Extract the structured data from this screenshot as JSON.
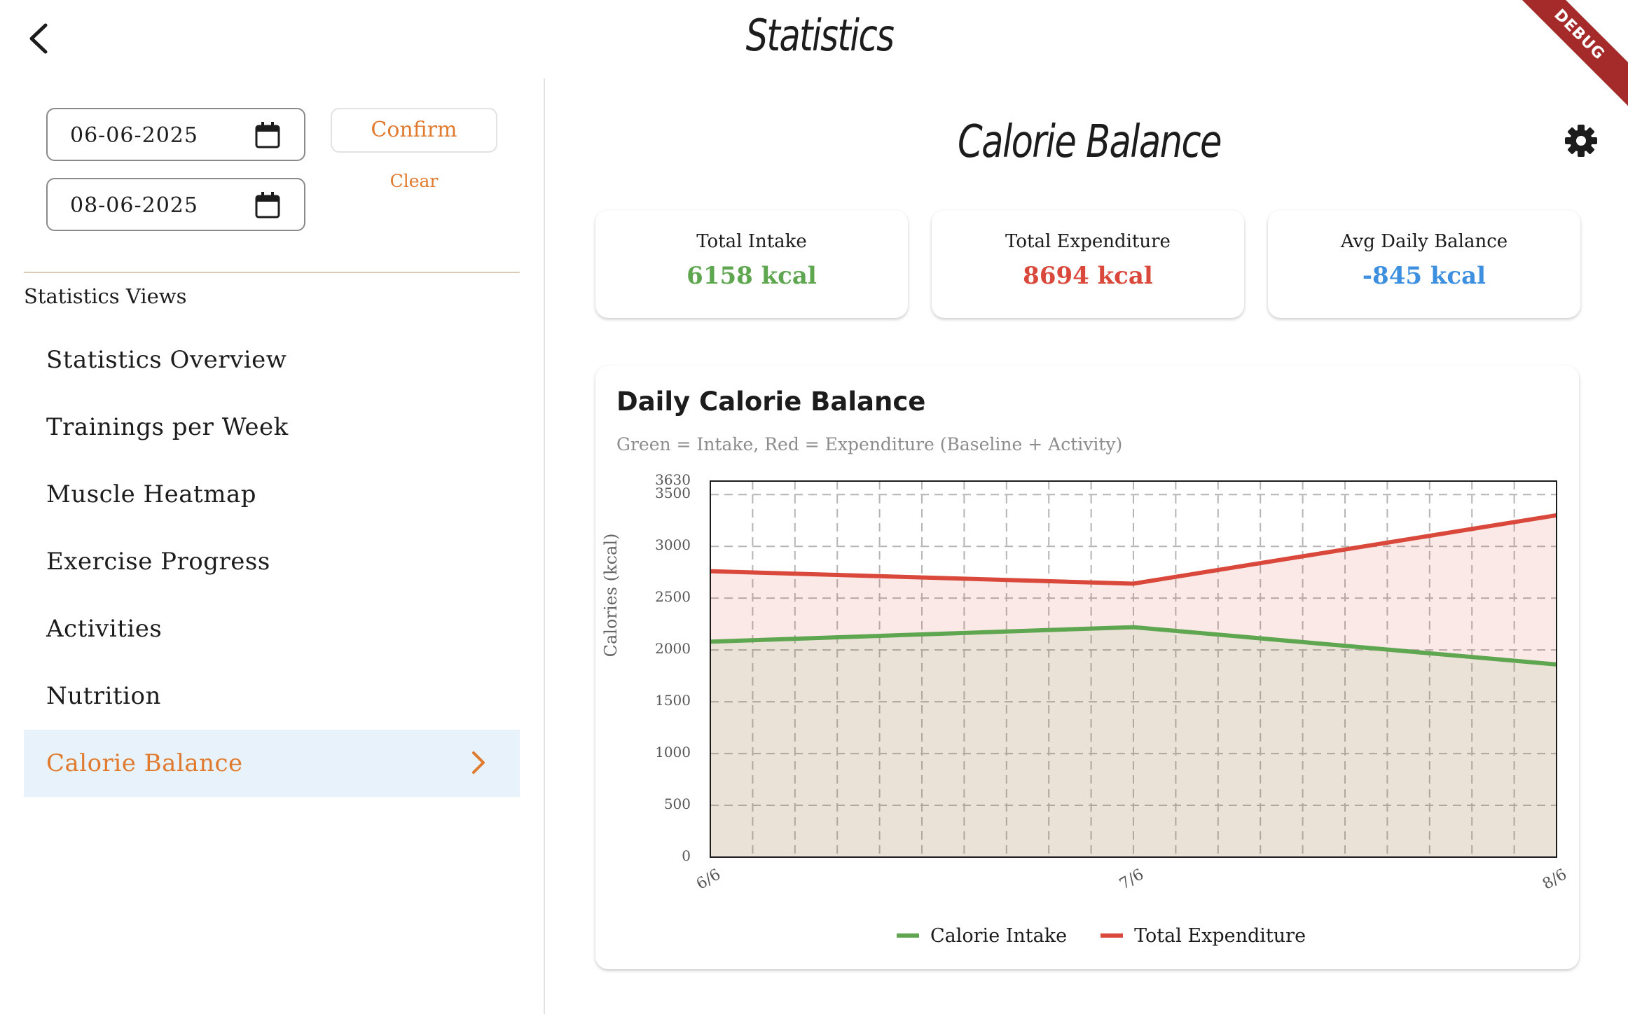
{
  "app": {
    "title": "Statistics",
    "debug_label": "DEBUG",
    "back_icon": "chevron-left-icon"
  },
  "filters": {
    "start_date": "06-06-2025",
    "end_date": "08-06-2025",
    "confirm_label": "Confirm",
    "clear_label": "Clear",
    "accent_color": "#e07a2e"
  },
  "sidebar": {
    "section_label": "Statistics Views",
    "items": [
      {
        "label": "Statistics Overview",
        "active": false
      },
      {
        "label": "Trainings per Week",
        "active": false
      },
      {
        "label": "Muscle Heatmap",
        "active": false
      },
      {
        "label": "Exercise Progress",
        "active": false
      },
      {
        "label": "Activities",
        "active": false
      },
      {
        "label": "Nutrition",
        "active": false
      },
      {
        "label": "Calorie Balance",
        "active": true
      }
    ]
  },
  "main": {
    "title": "Calorie Balance",
    "settings_icon": "gear-icon",
    "stats": [
      {
        "title": "Total Intake",
        "value": "6158 kcal",
        "color": "#5ea64f"
      },
      {
        "title": "Total Expenditure",
        "value": "8694 kcal",
        "color": "#d9483a"
      },
      {
        "title": "Avg Daily Balance",
        "value": "-845 kcal",
        "color": "#3d8fe0"
      }
    ],
    "chart_title": "Daily Calorie Balance",
    "chart_subtitle": "Green = Intake, Red = Expenditure (Baseline + Activity)"
  },
  "chart_data": {
    "type": "area",
    "x": [
      "6/6",
      "7/6",
      "8/6"
    ],
    "series": [
      {
        "name": "Calorie Intake",
        "values": [
          2080,
          2220,
          1860
        ],
        "color": "#5ea64f"
      },
      {
        "name": "Total Expenditure",
        "values": [
          2760,
          2640,
          3300
        ],
        "color": "#d9483a"
      }
    ],
    "ylabel": "Calories (kcal)",
    "ylim": [
      0,
      3630
    ],
    "yticks": [
      0,
      500,
      1000,
      1500,
      2000,
      2500,
      3000,
      3500,
      3630
    ],
    "grid": true,
    "legend_position": "bottom"
  }
}
